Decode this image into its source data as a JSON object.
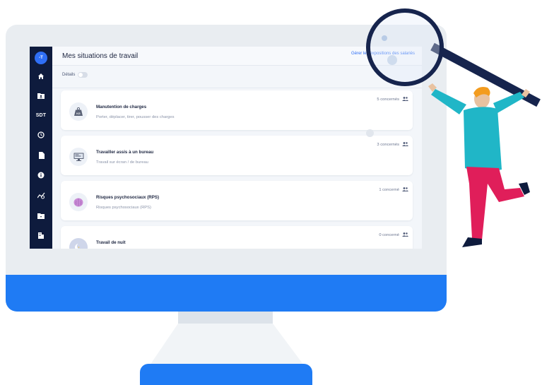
{
  "app": {
    "avatar_text": "-T",
    "title": "Mes situations de travail",
    "top_link": "Gérer les expositions des salariés"
  },
  "sidebar": {
    "items": [
      {
        "icon": "home-icon"
      },
      {
        "icon": "folder-person-icon"
      },
      {
        "label": "SDT"
      },
      {
        "icon": "clock-icon"
      },
      {
        "icon": "document-icon"
      },
      {
        "icon": "info-icon"
      },
      {
        "icon": "chart-icon"
      },
      {
        "icon": "folder-icon"
      },
      {
        "icon": "building-icon"
      }
    ]
  },
  "filters": {
    "details_label": "Détails",
    "details_enabled": false
  },
  "situations": [
    {
      "title": "Manutention de charges",
      "subtitle": "Porter, déplacer, tirer, pousser des charges",
      "count": "5 concernés",
      "icon": "weight-icon"
    },
    {
      "title": "Travailler assis à un bureau",
      "subtitle": "Travail sur écran / de bureau",
      "count": "3 concernés",
      "icon": "computer-icon"
    },
    {
      "title": "Risques psychosociaux (RPS)",
      "subtitle": "Risques psychosociaux (RPS)",
      "count": "1 concerné",
      "icon": "brain-icon"
    },
    {
      "title": "Travail de nuit",
      "subtitle": "",
      "count": "0 concerné",
      "icon": "moon-icon"
    }
  ],
  "colors": {
    "accent": "#1f7bf4",
    "sidebar": "#0e1b3d",
    "link": "#2f6ff5"
  }
}
